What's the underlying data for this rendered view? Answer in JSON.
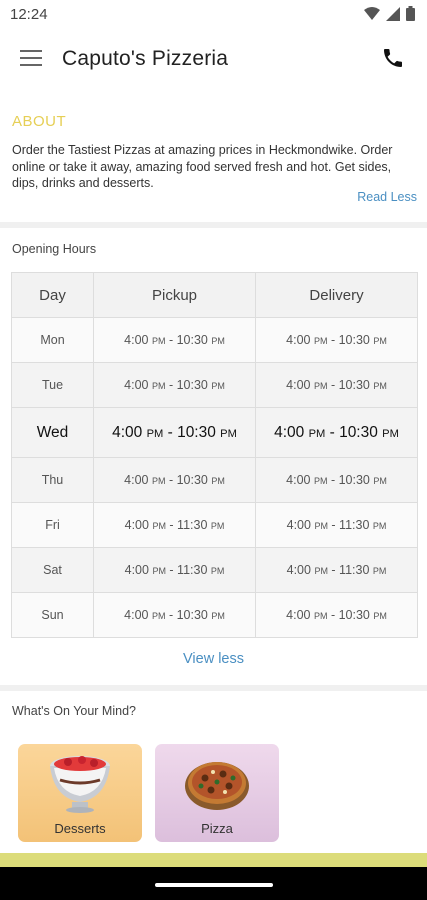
{
  "status_bar": {
    "time": "12:24"
  },
  "app_bar": {
    "title": "Caputo's Pizzeria",
    "menu_icon": "hamburger-menu-icon",
    "phone_icon": "phone-icon"
  },
  "about": {
    "heading": "ABOUT",
    "text": "Order the Tastiest Pizzas at amazing prices in Heckmondwike. Order online or take it away, amazing food served fresh and hot. Get sides, dips, drinks and desserts.",
    "read_less": "Read Less"
  },
  "opening_hours": {
    "heading": "Opening Hours",
    "columns": [
      "Day",
      "Pickup",
      "Delivery"
    ],
    "rows": [
      {
        "day": "Mon",
        "pickup": "4:00 PM - 10:30 PM",
        "delivery": "4:00 PM - 10:30 PM"
      },
      {
        "day": "Tue",
        "pickup": "4:00 PM - 10:30 PM",
        "delivery": "4:00 PM - 10:30 PM"
      },
      {
        "day": "Wed",
        "pickup": "4:00 PM - 10:30 PM",
        "delivery": "4:00 PM - 10:30 PM"
      },
      {
        "day": "Thu",
        "pickup": "4:00 PM - 10:30 PM",
        "delivery": "4:00 PM - 10:30 PM"
      },
      {
        "day": "Fri",
        "pickup": "4:00 PM - 11:30 PM",
        "delivery": "4:00 PM - 11:30 PM"
      },
      {
        "day": "Sat",
        "pickup": "4:00 PM - 11:30 PM",
        "delivery": "4:00 PM - 11:30 PM"
      },
      {
        "day": "Sun",
        "pickup": "4:00 PM - 10:30 PM",
        "delivery": "4:00 PM - 10:30 PM"
      }
    ],
    "highlighted_day": "Wed",
    "view_less": "View less"
  },
  "whats_on_your_mind": {
    "heading": "What's On Your Mind?",
    "categories": [
      {
        "label": "Desserts",
        "icon": "dessert-bowl-icon"
      },
      {
        "label": "Pizza",
        "icon": "pizza-icon"
      }
    ]
  },
  "colors": {
    "about_heading": "#e6cf55",
    "link": "#4a8fc2",
    "desserts_tile": "#f8cd88",
    "pizza_tile": "#e8cfe6",
    "bottom_strip": "#dcdc7a"
  }
}
